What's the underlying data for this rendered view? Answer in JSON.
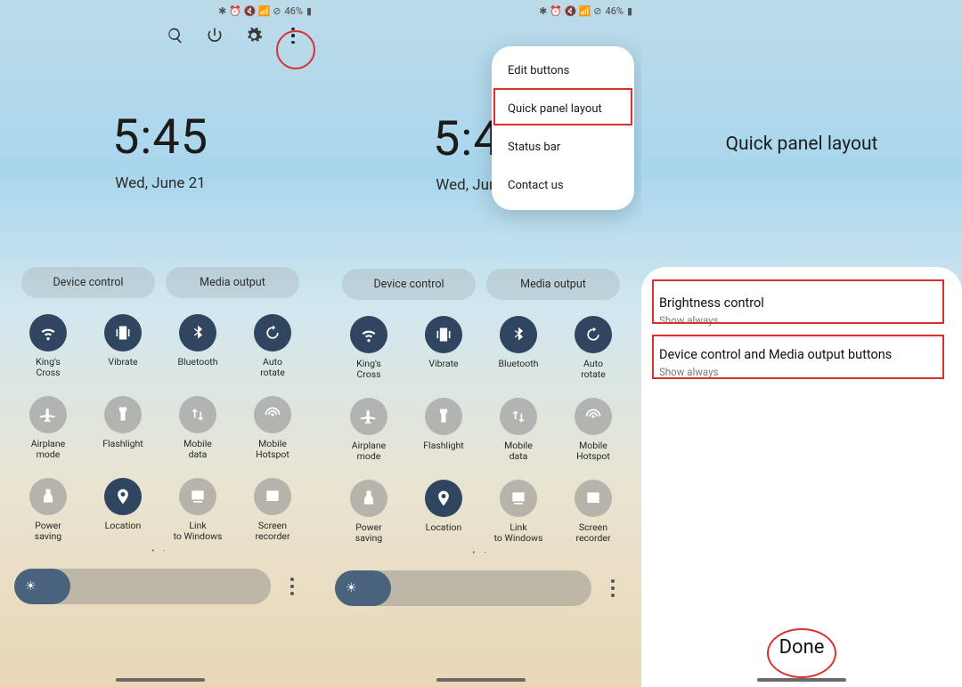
{
  "status": {
    "battery_pct": "46%",
    "glyphs": "✱ ⏰ 🔇 📶 ⊘"
  },
  "clock": {
    "time": "5:45",
    "date": "Wed, June 21"
  },
  "pills": {
    "device_control": "Device control",
    "media_output": "Media output"
  },
  "tiles": [
    {
      "key": "wifi",
      "label": "King's Cross",
      "on": true,
      "icon": "wifi"
    },
    {
      "key": "vibrate",
      "label": "Vibrate",
      "on": true,
      "icon": "vibrate"
    },
    {
      "key": "bluetooth",
      "label": "Bluetooth",
      "on": true,
      "icon": "bluetooth"
    },
    {
      "key": "autorotate",
      "label": "Auto rotate",
      "on": true,
      "icon": "rotate"
    },
    {
      "key": "airplane",
      "label": "Airplane mode",
      "on": false,
      "icon": "airplane"
    },
    {
      "key": "flashlight",
      "label": "Flashlight",
      "on": false,
      "icon": "flashlight"
    },
    {
      "key": "mobiledata",
      "label": "Mobile data",
      "on": false,
      "icon": "mobiledata"
    },
    {
      "key": "hotspot",
      "label": "Mobile Hotspot",
      "on": false,
      "icon": "hotspot"
    },
    {
      "key": "powersaving",
      "label": "Power saving",
      "on": false,
      "icon": "power"
    },
    {
      "key": "location",
      "label": "Location",
      "on": true,
      "icon": "location"
    },
    {
      "key": "linkwin",
      "label": "Link to Windows",
      "on": false,
      "icon": "linkwin"
    },
    {
      "key": "screenrec",
      "label": "Screen recorder",
      "on": false,
      "icon": "screenrec"
    }
  ],
  "slider": {
    "fill_pct": 22
  },
  "popup": {
    "items": [
      {
        "key": "edit",
        "label": "Edit buttons"
      },
      {
        "key": "layout",
        "label": "Quick panel layout"
      },
      {
        "key": "status",
        "label": "Status bar"
      },
      {
        "key": "contact",
        "label": "Contact us"
      }
    ]
  },
  "panel3": {
    "title": "Quick panel layout",
    "options": [
      {
        "title": "Brightness control",
        "sub": "Show always"
      },
      {
        "title": "Device control and Media output buttons",
        "sub": "Show always"
      }
    ],
    "done": "Done"
  },
  "colors": {
    "tile_on": "#2f4560",
    "accent_red": "#d9302f"
  }
}
